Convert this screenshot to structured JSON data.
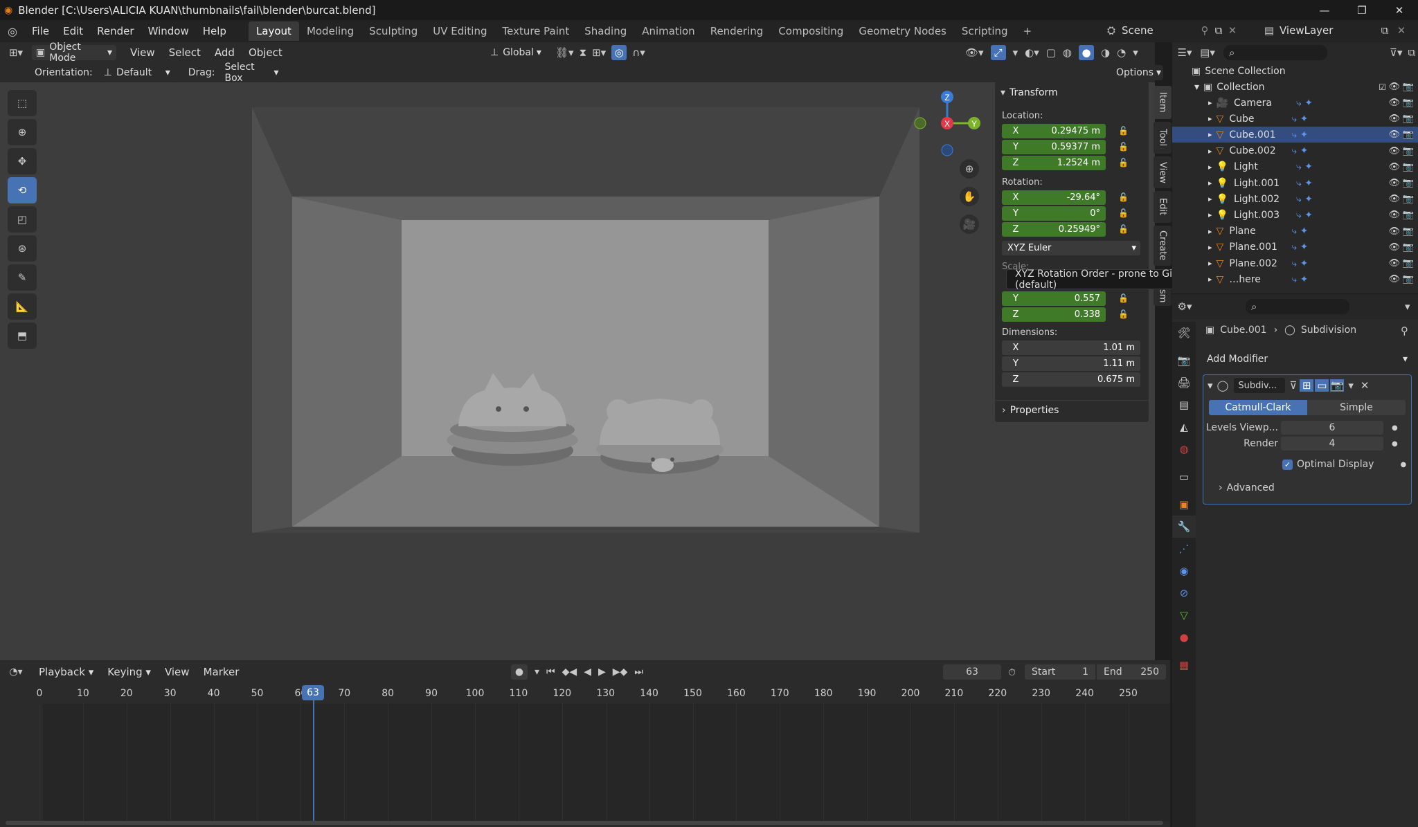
{
  "titlebar": {
    "title": "Blender [C:\\Users\\ALICIA KUAN\\thumbnails\\fail\\blender\\burcat.blend]",
    "minimize": "—",
    "maximize": "❐",
    "close": "✕"
  },
  "menubar": {
    "menus": [
      "File",
      "Edit",
      "Render",
      "Window",
      "Help"
    ],
    "workspaces": [
      "Layout",
      "Modeling",
      "Sculpting",
      "UV Editing",
      "Texture Paint",
      "Shading",
      "Animation",
      "Rendering",
      "Compositing",
      "Geometry Nodes",
      "Scripting"
    ],
    "active_workspace": "Layout",
    "add_tab": "+",
    "scene": "Scene",
    "view_layer": "ViewLayer"
  },
  "viewport_header": {
    "mode": "Object Mode",
    "menus": [
      "View",
      "Select",
      "Add",
      "Object"
    ],
    "transform_orientation": "Global"
  },
  "viewport_subheader": {
    "orientation_label": "Orientation:",
    "orientation_value": "Default",
    "drag_label": "Drag:",
    "drag_value": "Select Box",
    "options": "Options"
  },
  "gizmo": {
    "z": "Z",
    "x": "X",
    "y": "Y"
  },
  "npanel": {
    "transform_title": "Transform",
    "location_label": "Location:",
    "location": [
      {
        "axis": "X",
        "value": "0.29475 m"
      },
      {
        "axis": "Y",
        "value": "0.59377 m"
      },
      {
        "axis": "Z",
        "value": "1.2524 m"
      }
    ],
    "rotation_label": "Rotation:",
    "rotation": [
      {
        "axis": "X",
        "value": "-29.64°"
      },
      {
        "axis": "Y",
        "value": "0°"
      },
      {
        "axis": "Z",
        "value": "0.25949°"
      }
    ],
    "rotation_mode": "XYZ Euler",
    "scale_label": "Scale:",
    "scale": [
      {
        "axis": "Y",
        "value": "0.557"
      },
      {
        "axis": "Z",
        "value": "0.338"
      }
    ],
    "dimensions_label": "Dimensions:",
    "dimensions": [
      {
        "axis": "X",
        "value": "1.01 m"
      },
      {
        "axis": "Y",
        "value": "1.11 m"
      },
      {
        "axis": "Z",
        "value": "0.675 m"
      }
    ],
    "properties_title": "Properties",
    "tooltip": "XYZ Rotation Order - prone to Gimbal Lock (default)",
    "side_tabs": [
      "Item",
      "Tool",
      "View",
      "Edit",
      "Create",
      "sm"
    ]
  },
  "outliner": {
    "scene_collection": "Scene Collection",
    "collection": "Collection",
    "items": [
      "Camera",
      "Cube",
      "Cube.001",
      "Cube.002",
      "Light",
      "Light.001",
      "Light.002",
      "Light.003",
      "Plane",
      "Plane.001",
      "Plane.002",
      "…here"
    ]
  },
  "properties": {
    "breadcrumb_object": "Cube.001",
    "breadcrumb_modifier": "Subdivision",
    "add_modifier": "Add Modifier",
    "modifier_name": "Subdiv...",
    "catmull": "Catmull-Clark",
    "simple": "Simple",
    "levels_viewport_label": "Levels Viewp...",
    "levels_viewport": "6",
    "render_label": "Render",
    "render_value": "4",
    "optimal_display": "Optimal Display",
    "advanced": "Advanced"
  },
  "timeline": {
    "menus": [
      "Playback",
      "Keying",
      "View",
      "Marker"
    ],
    "current_frame": "63",
    "start_label": "Start",
    "start": "1",
    "end_label": "End",
    "end": "250",
    "ticks": [
      "0",
      "10",
      "20",
      "30",
      "40",
      "50",
      "60",
      "70",
      "80",
      "90",
      "100",
      "110",
      "120",
      "130",
      "140",
      "150",
      "160",
      "170",
      "180",
      "190",
      "200",
      "210",
      "220",
      "230",
      "240",
      "250"
    ]
  },
  "colors": {
    "accent": "#4772b3",
    "field_green": "#3e7a28",
    "background": "#1d1d1d"
  }
}
